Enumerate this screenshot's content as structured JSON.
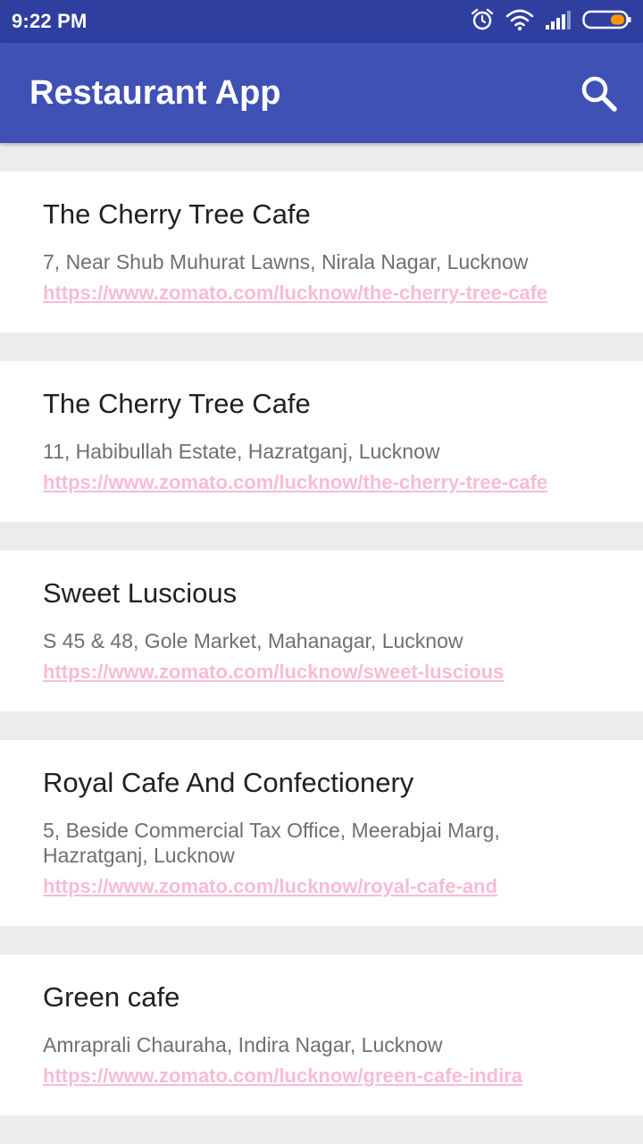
{
  "status_bar": {
    "time": "9:22 PM",
    "icons": [
      "alarm-icon",
      "wifi-icon",
      "signal-icon",
      "battery-icon"
    ]
  },
  "app_bar": {
    "title": "Restaurant App",
    "search_icon": "search-icon"
  },
  "colors": {
    "status_bar": "#2f3f9f",
    "app_bar": "#3f51b5",
    "background": "#ececec",
    "card": "#ffffff",
    "link": "#f8bbd5",
    "battery_fill": "#ff9800"
  },
  "restaurants": [
    {
      "name": "The Cherry Tree Cafe",
      "address": "7, Near Shub Muhurat Lawns, Nirala Nagar, Lucknow",
      "url": "https://www.zomato.com/lucknow/the-cherry-tree-cafe"
    },
    {
      "name": "The Cherry Tree Cafe",
      "address": "11, Habibullah Estate, Hazratganj, Lucknow",
      "url": "https://www.zomato.com/lucknow/the-cherry-tree-cafe"
    },
    {
      "name": "Sweet Luscious",
      "address": "S 45 & 48, Gole Market, Mahanagar, Lucknow",
      "url": "https://www.zomato.com/lucknow/sweet-luscious"
    },
    {
      "name": "Royal Cafe And Confectionery",
      "address": "5, Beside Commercial Tax Office, Meerabjai Marg, Hazratganj, Lucknow",
      "url": "https://www.zomato.com/lucknow/royal-cafe-and"
    },
    {
      "name": "Green cafe",
      "address": "Amraprali Chauraha, Indira Nagar, Lucknow",
      "url": "https://www.zomato.com/lucknow/green-cafe-indira"
    }
  ]
}
